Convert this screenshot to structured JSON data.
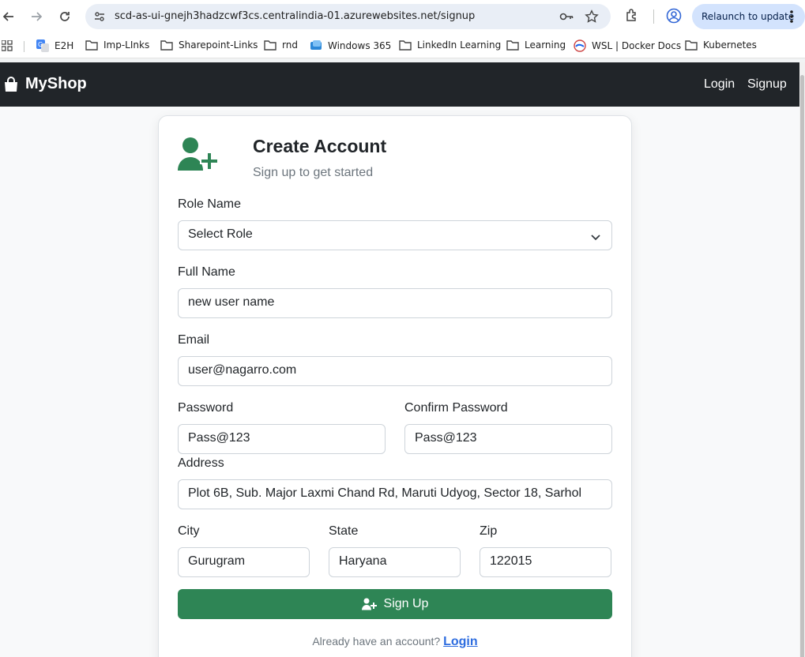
{
  "browser": {
    "url": "scd-as-ui-gnejh3hadzcwf3cs.centralindia-01.azurewebsites.net/signup",
    "relaunch_label": "Relaunch to update",
    "bookmarks": [
      {
        "label": "E2H",
        "icon": "translate-icon"
      },
      {
        "label": "Imp-LInks",
        "icon": "folder-icon"
      },
      {
        "label": "Sharepoint-Links",
        "icon": "folder-icon"
      },
      {
        "label": "rnd",
        "icon": "folder-icon"
      },
      {
        "label": "Windows 365",
        "icon": "windows365-icon"
      },
      {
        "label": "LinkedIn Learning",
        "icon": "folder-icon"
      },
      {
        "label": "Learning",
        "icon": "folder-icon"
      },
      {
        "label": "WSL | Docker Docs",
        "icon": "docker-icon"
      },
      {
        "label": "Kubernetes",
        "icon": "folder-icon"
      }
    ]
  },
  "navbar": {
    "brand": "MyShop",
    "login": "Login",
    "signup": "Signup"
  },
  "form": {
    "title": "Create Account",
    "subtitle": "Sign up to get started",
    "role_label": "Role Name",
    "role_value": "Select Role",
    "fullname_label": "Full Name",
    "fullname_value": "new user name",
    "email_label": "Email",
    "email_value": "user@nagarro.com",
    "password_label": "Password",
    "password_value": "Pass@123",
    "confirm_label": "Confirm Password",
    "confirm_value": "Pass@123",
    "address_label": "Address",
    "address_value": "Plot 6B, Sub. Major Laxmi Chand Rd, Maruti Udyog, Sector 18, Sarhol",
    "city_label": "City",
    "city_value": "Gurugram",
    "state_label": "State",
    "state_value": "Haryana",
    "zip_label": "Zip",
    "zip_value": "122015",
    "submit_label": "Sign Up",
    "already_text": "Already have an account?",
    "login_link": "Login"
  },
  "colors": {
    "accent_green": "#2e8555",
    "navbar_bg": "#212529",
    "link_blue": "#2d6cdf"
  }
}
